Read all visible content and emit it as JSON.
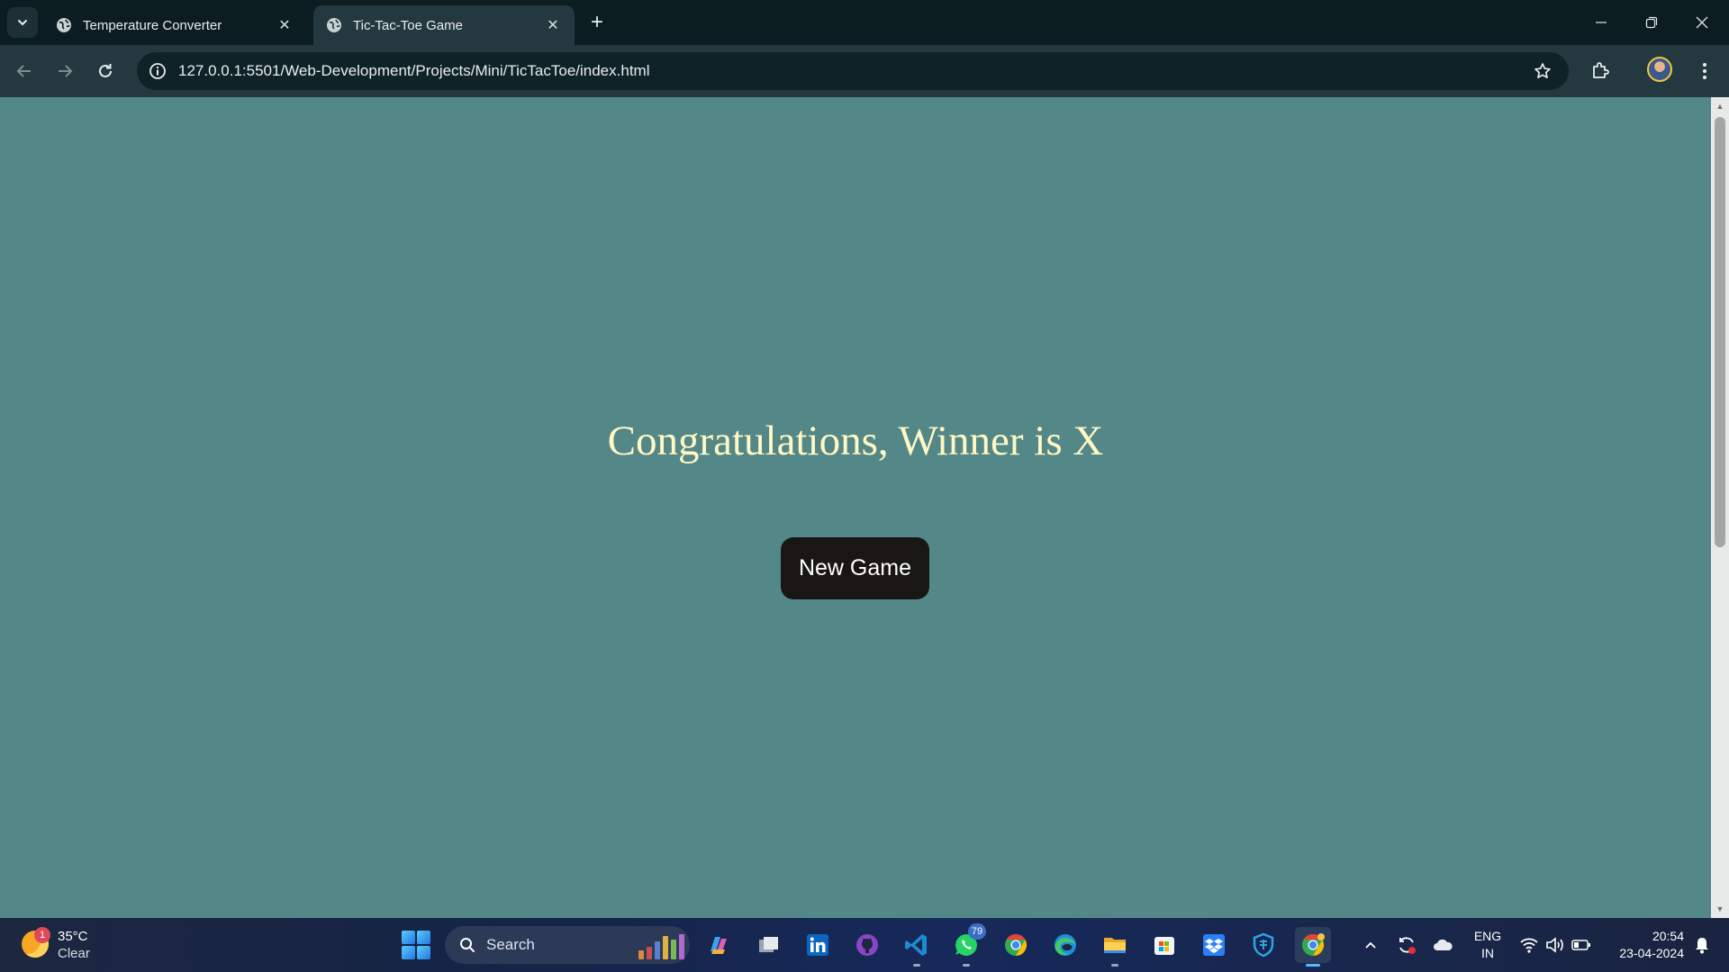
{
  "browser": {
    "tabs": [
      {
        "title": "Temperature Converter",
        "active": false,
        "icon": "globe-icon"
      },
      {
        "title": "Tic-Tac-Toe Game",
        "active": true,
        "icon": "globe-icon"
      }
    ],
    "url": "127.0.0.1:5501/Web-Development/Projects/Mini/TicTacToe/index.html"
  },
  "page": {
    "message": "Congratulations, Winner is X",
    "new_game_label": "New Game",
    "background_color": "#548787",
    "message_color": "#fff8c4",
    "button_color": "#191714"
  },
  "taskbar": {
    "weather": {
      "temperature": "35°C",
      "condition": "Clear",
      "badge": "1"
    },
    "search_label": "Search",
    "apps": [
      "copilot-icon",
      "task-view-icon",
      "linkedin-icon",
      "github-icon",
      "vscode-icon",
      "whatsapp-icon",
      "chrome-icon",
      "edge-icon",
      "file-explorer-icon",
      "microsoft-store-icon",
      "dropbox-icon",
      "windows-security-icon",
      "chrome-canary-icon"
    ],
    "whatsapp_badge": "79",
    "language": {
      "line1": "ENG",
      "line2": "IN"
    },
    "clock": {
      "time": "20:54",
      "date": "23-04-2024"
    }
  }
}
